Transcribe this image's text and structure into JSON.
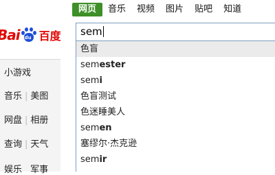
{
  "topnav": [
    "网页",
    "音乐",
    "视频",
    "图片",
    "贴吧",
    "知道"
  ],
  "logo": {
    "text": "Bai",
    "paw_text": "du",
    "cn": "百度",
    "brand_color": "#e10602",
    "paw_color": "#1d4ed8"
  },
  "search": {
    "value": "sem"
  },
  "suggestions": [
    {
      "prefix": "色盲",
      "rest": ""
    },
    {
      "prefix": "sem",
      "rest": "ester"
    },
    {
      "prefix": "sem",
      "rest": "i"
    },
    {
      "prefix": "色盲测试",
      "rest": ""
    },
    {
      "prefix": "色迷睡美人",
      "rest": ""
    },
    {
      "prefix": "sem",
      "rest": "en"
    },
    {
      "prefix": "塞缪尔·杰克逊",
      "rest": ""
    },
    {
      "prefix": "sem",
      "rest": "ir"
    }
  ],
  "side": {
    "line1": "小游戏",
    "line2": [
      "音乐",
      "美图"
    ],
    "line3": [
      "网盘",
      "相册"
    ],
    "line4": [
      "查询",
      "天气"
    ],
    "line5": [
      "娱乐",
      "军事"
    ]
  },
  "colors": {
    "nav_active": "#3e8f28",
    "input_border": "#7b9ebd",
    "highlight": "#ebebeb"
  }
}
